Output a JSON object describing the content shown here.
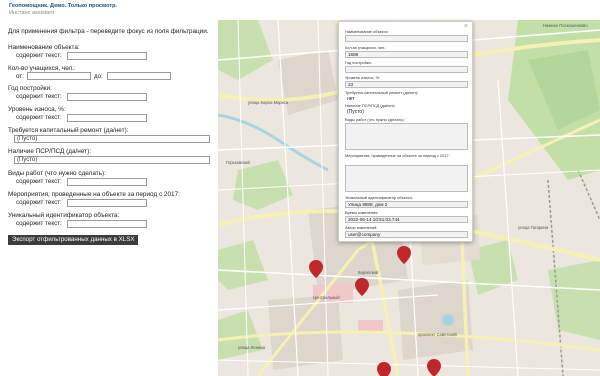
{
  "app": {
    "title": "Геопомощник. Демо. Только просмотр.",
    "subtitle": "Инстанс assistant"
  },
  "filters": {
    "hint": "Для применения фильтра - переведите фокус из поля фильтрации.",
    "object_name": {
      "label": "Наименование объекта:",
      "sub": "содержит текст:",
      "value": ""
    },
    "students": {
      "label": "Кол-во учащихся, чел.:",
      "from_label": "от:",
      "to_label": "до:",
      "from_value": "",
      "to_value": ""
    },
    "year_built": {
      "label": "Год постройки:",
      "sub": "содержит текст:",
      "value": ""
    },
    "wear_level": {
      "label": "Уровень износа, %:",
      "sub": "содержит текст:",
      "value": ""
    },
    "capital_repair": {
      "label": "Требуется капитальный ремонт (да/нет):",
      "value": "(Пусто)"
    },
    "psd": {
      "label": "Наличие ПСР/ПСД (да/нет):",
      "value": "(Пусто)"
    },
    "work_types": {
      "label": "Виды работ (что нужно сделать):",
      "sub": "содержит текст:",
      "value": ""
    },
    "events_2017": {
      "label": "Мероприятия, проведенные на объекте за период с 2017:",
      "sub": "содержит текст:",
      "value": ""
    },
    "uid": {
      "label": "Уникальный идентификатор объекта:",
      "sub": "содержит текст:",
      "value": ""
    },
    "export_button": "Экспорт отфильтрованных данных в XLSX"
  },
  "popup": {
    "close": "×",
    "fields": [
      {
        "label": "Наименование объекта:",
        "value": ""
      },
      {
        "label": "Кол-во учащихся, чел.:",
        "value": "1688"
      },
      {
        "label": "Год постройки:",
        "value": ""
      },
      {
        "label": "Уровень износа, %:",
        "value": "23"
      },
      {
        "label": "Требуется капитальный ремонт (да/нет):",
        "value": "нет"
      },
      {
        "label": "Наличие ПСР/ПСД (да/нет):",
        "value": "(Пусто)"
      },
      {
        "label": "Виды работ (что нужно сделать):",
        "value": ""
      },
      {
        "label": "Мероприятия, проведенные на объекте за период с 2017:",
        "value": ""
      },
      {
        "label": "Уникальный идентификатор объекта:",
        "value": "Улица 8888, дом 2"
      },
      {
        "label": "Время изменения:",
        "value": "2022-06-14 10:51:03.744"
      },
      {
        "label": "Автор изменений:",
        "value": "user@company"
      }
    ]
  },
  "map": {
    "labels": {
      "district_top": "Нижнее Поскешенково",
      "district_left": "Горьковский",
      "district_mid": "Кировский",
      "street_a": "улица Карла Маркса",
      "street_b": "проспект Советский",
      "street_c": "улица Гагарина",
      "street_d": "улица Ленина",
      "street_e": "Центральный"
    },
    "colors": {
      "background": "#ece7de",
      "forest": "#c2dfa8",
      "road_major": "#f6f0b4",
      "road_minor": "#ffffff",
      "water": "#aad3df",
      "marker": "#c0272d"
    },
    "marker_icon": "map-pin-icon"
  }
}
